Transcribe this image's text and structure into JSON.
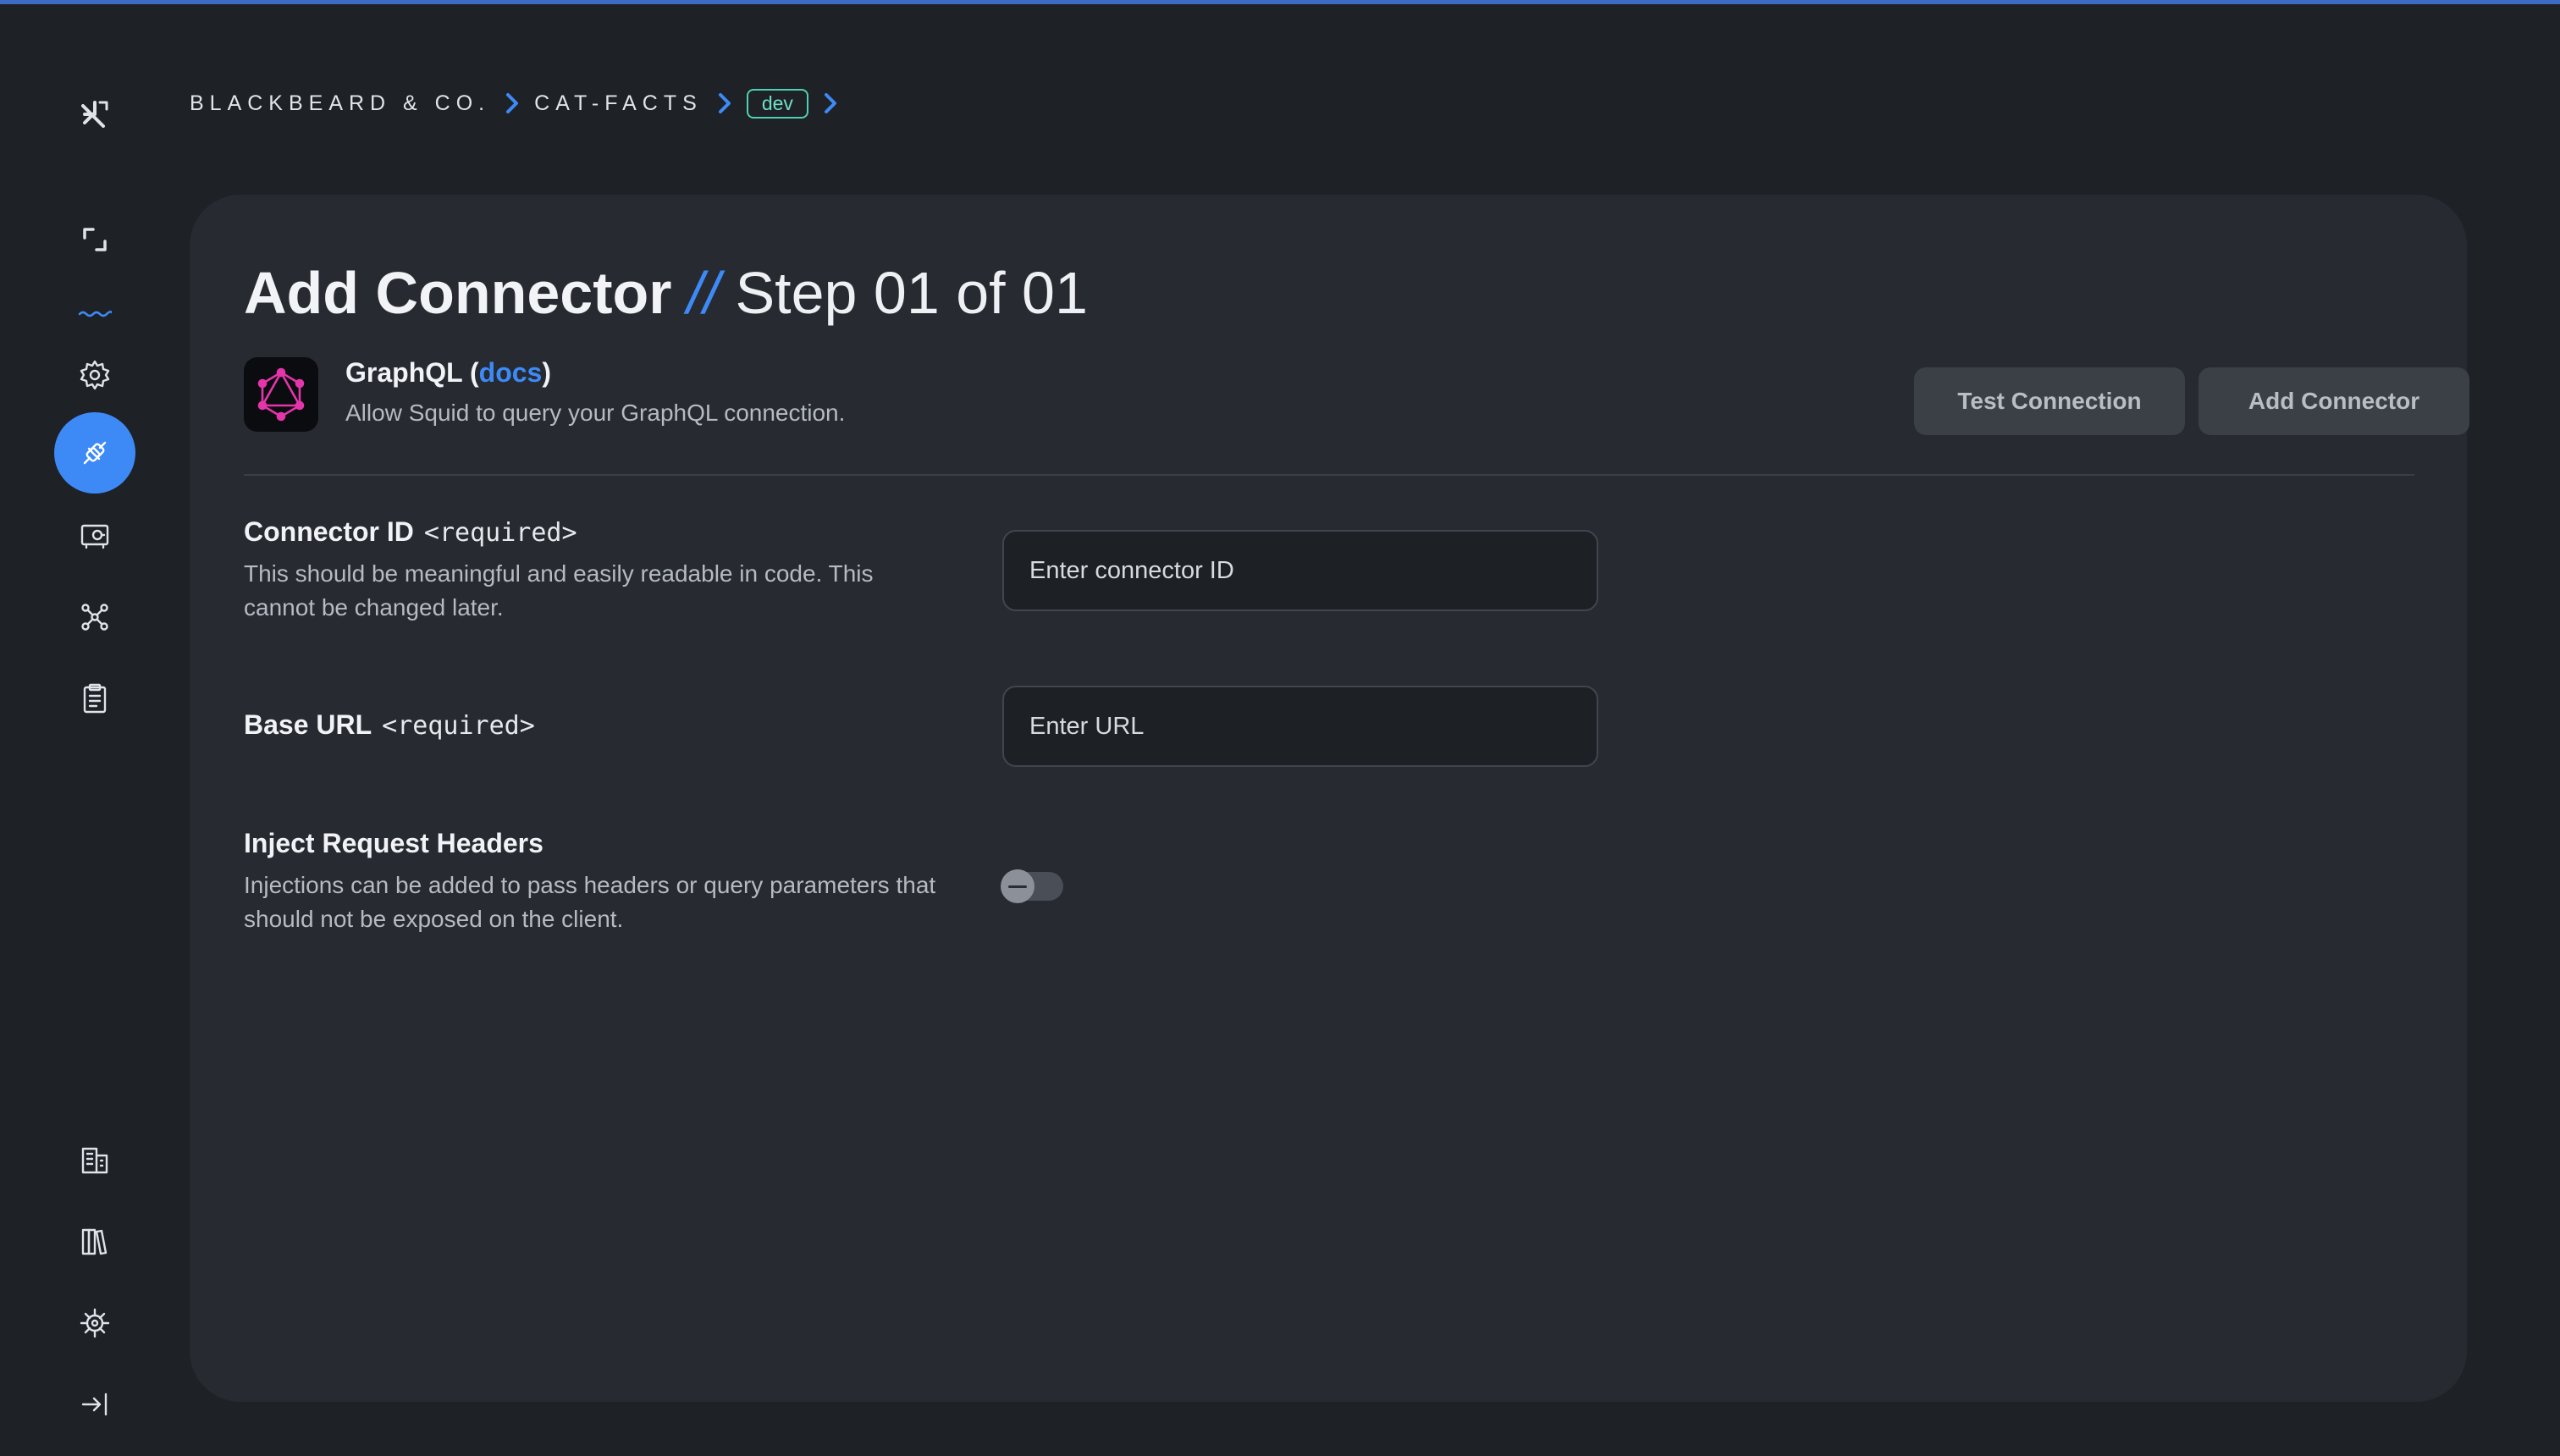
{
  "breadcrumb": {
    "org": "BLACKBEARD & CO.",
    "app": "CAT-FACTS",
    "env": "dev"
  },
  "sidebar": {
    "top_items": [
      "logo-icon",
      "overview-icon",
      "wave-icon",
      "settings-icon",
      "connectors-icon",
      "secrets-icon",
      "integrations-icon",
      "clipboard-icon"
    ],
    "bottom_items": [
      "organization-icon",
      "library-icon",
      "gear-icon",
      "logout-icon"
    ],
    "active": "connectors-icon"
  },
  "page": {
    "title": "Add Connector",
    "title_separator": "//",
    "step": "Step 01 of 01"
  },
  "connector": {
    "name_prefix": "GraphQL (",
    "docs_label": "docs",
    "name_suffix": ")",
    "description": "Allow Squid to query your GraphQL connection."
  },
  "actions": {
    "test_label": "Test Connection",
    "add_label": "Add Connector"
  },
  "fields": {
    "connector_id": {
      "label": "Connector ID",
      "required": "<required>",
      "description": "This should be meaningful and easily readable in code. This cannot be changed later.",
      "placeholder": "Enter connector ID",
      "value": ""
    },
    "base_url": {
      "label": "Base URL",
      "required": "<required>",
      "placeholder": "Enter URL",
      "value": ""
    },
    "inject_headers": {
      "label": "Inject Request Headers",
      "description": "Injections can be added to pass headers or query parameters that should not be exposed on the client.",
      "enabled": false
    }
  },
  "colors": {
    "accent": "#3d8af7",
    "env_badge": "#4fd0b5",
    "graphql_pink": "#e535ab"
  }
}
